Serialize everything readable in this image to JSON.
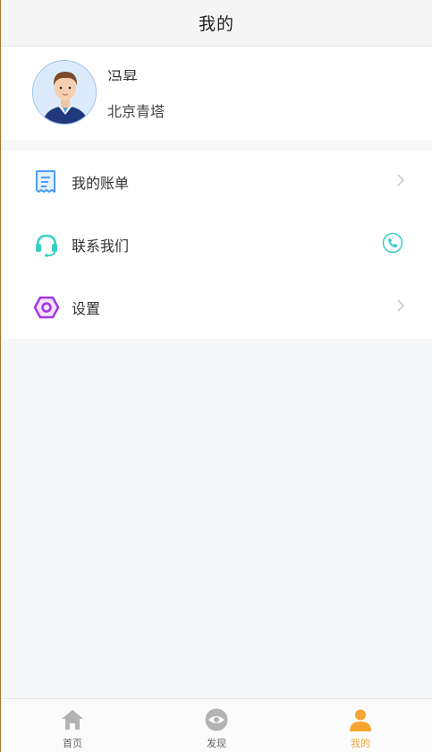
{
  "header": {
    "title": "我的"
  },
  "profile": {
    "name": "冯昇",
    "location": "北京青塔"
  },
  "menu": [
    {
      "label": "我的账单",
      "icon": "bill-icon",
      "right": "chevron-right-icon"
    },
    {
      "label": "联系我们",
      "icon": "headset-icon",
      "right": "phone-icon"
    },
    {
      "label": "设置",
      "icon": "settings-icon",
      "right": "chevron-right-icon"
    }
  ],
  "tabs": [
    {
      "label": "首页",
      "icon": "home-icon",
      "active": false
    },
    {
      "label": "发现",
      "icon": "discover-icon",
      "active": false
    },
    {
      "label": "我的",
      "icon": "profile-icon",
      "active": true
    }
  ],
  "colors": {
    "accent": "#f7a531",
    "teal": "#35d0c3",
    "blue": "#4d9ef5",
    "purple": "#a335e6"
  }
}
